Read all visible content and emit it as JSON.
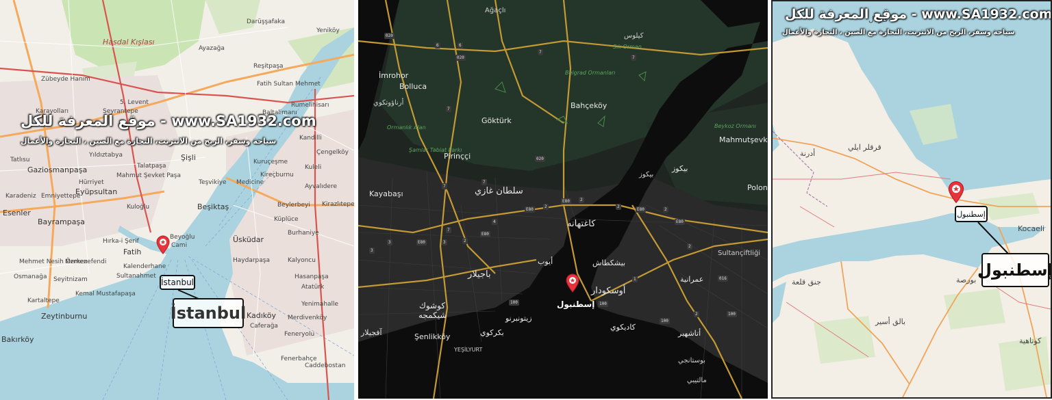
{
  "watermark": {
    "title": "موقع المعرفة للكل - www.SA1932.com",
    "subtitle": "سياحة وسفر، الربح من الانترنت، التجارة مع الصين ، التجارة والأعمال"
  },
  "panel_light": {
    "places": [
      "Hasdal Kışlası",
      "Darüşşafaka",
      "Yeniköy",
      "Ayazağa",
      "Zübeyde Hanım",
      "Reşitpaşa",
      "Fatih Sultan Mehmet",
      "5. Levent",
      "Rumelihisarı",
      "Karayolları",
      "Seyrantepe",
      "Baltalimanı",
      "Kandilli",
      "Çengelköy",
      "Gaziosmanpaşa",
      "Şişli",
      "Kuruçeşme",
      "Tatlısu",
      "Yıldıztabya",
      "Talatpaşa",
      "Mahmut Şevket Paşa",
      "Hürriyet",
      "Teşvikiye",
      "Medicine",
      "Kireçburnu",
      "Kuleli",
      "Karadeniz",
      "Ayvalıdere",
      "Emniyettepe",
      "Eyüpsultan",
      "Kuloğlu",
      "Beşiktaş",
      "Beylerbeyi",
      "Kirazlıtepe",
      "Esenler",
      "Bayrampaşa",
      "Cami",
      "Beyoğlu",
      "Küplüce",
      "Burhaniye",
      "Fatih",
      "Hırka-i Şerif",
      "Üsküdar",
      "Mehmet Nesih Özmen",
      "Merkezefendi",
      "Kalenderhane",
      "Haydarpaşa",
      "Seyitnizam",
      "Sultanahmet",
      "Kemal Mustafapaşa",
      "Kalyoncu",
      "Zeytinburnu",
      "Bakırköy",
      "Kadıköy",
      "Merdivenköy",
      "Caferağa",
      "Feneryolu",
      "Fenerbahçe",
      "Caddebostan",
      "Osmanağa",
      "Atatürk",
      "Hasanpaşa",
      "Kartaltepe",
      "Yenimahalle"
    ],
    "city_label": "İstanbul",
    "zoom_label": "İstanbul"
  },
  "panel_dark": {
    "places": [
      "Ağaçlı",
      "كيلوس",
      "Sık Orman",
      "İmrohor",
      "Bolluca",
      "أرناؤوتكوي",
      "Göktürk",
      "Belgrad Ormanları",
      "Bahçeköy",
      "Ormanlık Alan",
      "Şamlar Tabiat Parkı",
      "Pirinççi",
      "Kayabaşı",
      "سلطان غازي",
      "Beykoz Ormanı",
      "Mahmutşevketpaşa",
      "بيكوز",
      "بيكوز",
      "Polon",
      "كاغتهانه",
      "بيشكطاش",
      "عمرانية",
      "Sultançiftliği",
      "كوشوك شيكمجه",
      "باجيلار",
      "أيوب",
      "أوسكودار",
      "بكركوي",
      "زيتونبرنو",
      "كاديكوي",
      "أتاشهير",
      "بوستانجي",
      "مالتيبي",
      "Şenlikköy",
      "YEŞİLYURT",
      "آفجيلار"
    ],
    "city_label": "إسطنبول"
  },
  "panel_region": {
    "places": [
      "قرقلر ايلي",
      "أدرنة",
      "بالق أسير",
      "جنق قلعة",
      "بورصة",
      "كوتاهية",
      "Kocaeli",
      "قارتال"
    ],
    "city_label": "إسطنبول",
    "zoom_label": "إسطنبول"
  },
  "colors": {
    "water_light": "#aad3df",
    "land_light": "#f2efe9",
    "land_dark": "#1f2622",
    "road_dark": "#c49a34",
    "pin": "#e8323c"
  },
  "icons": [
    "map-pin-star-icon"
  ]
}
